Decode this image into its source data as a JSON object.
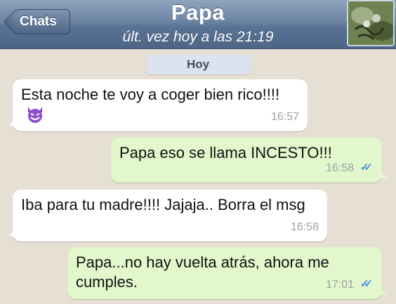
{
  "header": {
    "back_label": "Chats",
    "title": "Papa",
    "subtitle": "últ. vez hoy a las 21:19"
  },
  "chat": {
    "day_label": "Hoy",
    "messages": [
      {
        "direction": "in",
        "text": "Esta noche te voy a coger bien rico!!!!",
        "emoji": "smiling-devil-emoji",
        "time": "16:57"
      },
      {
        "direction": "out",
        "text": "Papa eso se llama INCESTO!!!",
        "time": "16:58",
        "status": "read"
      },
      {
        "direction": "in",
        "text": "Iba para tu madre!!!! Jajaja.. Borra el msg",
        "time": "16:58"
      },
      {
        "direction": "out",
        "text": "Papa...no hay vuelta atrás, ahora me cumples.",
        "time": "17:01",
        "status": "read"
      }
    ]
  },
  "colors": {
    "header": "#5a7394",
    "incoming_bubble": "#ffffff",
    "outgoing_bubble": "#e2f7cc",
    "read_check": "#4a8fdc",
    "background": "#e6dfd4"
  }
}
